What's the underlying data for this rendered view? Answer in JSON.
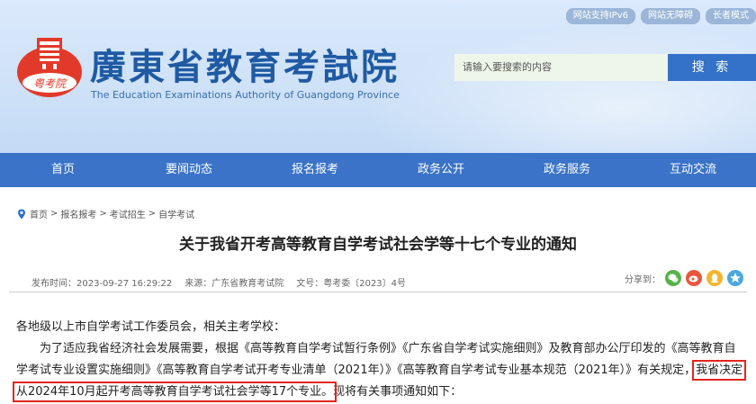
{
  "header": {
    "top_links": [
      "网站支持IPv6",
      "网站无障碍",
      "长者模式"
    ],
    "logo_cn": "廣東省教育考試院",
    "logo_en": "The Education Examinations Authority of Guangdong Province",
    "logo_seal_text": "粤考院",
    "search_placeholder": "请输入要搜索的内容",
    "search_button": "搜 索"
  },
  "nav": [
    "首页",
    "要闻动态",
    "报名报考",
    "政务公开",
    "政务服务",
    "互动交流"
  ],
  "breadcrumb": [
    "首页",
    "报名报考",
    "考试招生",
    "自学考试"
  ],
  "article": {
    "title": "关于我省开考高等教育自学考试社会学等十七个专业的通知",
    "date": "发布时间：2023-09-27 16:29:22",
    "source": "来源：广东省教育考试院",
    "doc_no": "文号：粤考委〔2023〕4号",
    "share_label": "分享到：",
    "greeting": "各地级以上市自学考试工作委员会，相关主考学校：",
    "para_before": "为了适应我省经济社会发展需要，根据《高等教育自学考试暂行条例》《广东省自学考试实施细则》及教育部办公厅印发的《高等教育自学考试专业设置实施细则》《高等教育自学考试开考专业清单（2021年）》《高等教育自学考试专业基本规范（2021年）》有关规定，",
    "para_highlight": "我省决定从2024年10月起开考高等教育自学考试社会学等17个专业。",
    "para_after": "现将有关事项通知如下："
  },
  "colors": {
    "nav": "#3a73c8",
    "highlight": "#e2261d",
    "logo": "#1f5aa3"
  }
}
